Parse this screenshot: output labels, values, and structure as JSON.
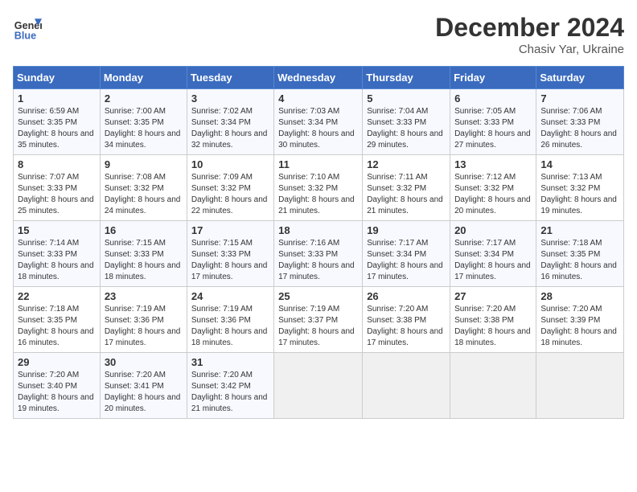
{
  "header": {
    "logo_text_line1": "General",
    "logo_text_line2": "Blue",
    "month": "December 2024",
    "location": "Chasiv Yar, Ukraine"
  },
  "weekdays": [
    "Sunday",
    "Monday",
    "Tuesday",
    "Wednesday",
    "Thursday",
    "Friday",
    "Saturday"
  ],
  "weeks": [
    [
      {
        "day": "1",
        "sunrise": "6:59 AM",
        "sunset": "3:35 PM",
        "daylight": "8 hours and 35 minutes."
      },
      {
        "day": "2",
        "sunrise": "7:00 AM",
        "sunset": "3:35 PM",
        "daylight": "8 hours and 34 minutes."
      },
      {
        "day": "3",
        "sunrise": "7:02 AM",
        "sunset": "3:34 PM",
        "daylight": "8 hours and 32 minutes."
      },
      {
        "day": "4",
        "sunrise": "7:03 AM",
        "sunset": "3:34 PM",
        "daylight": "8 hours and 30 minutes."
      },
      {
        "day": "5",
        "sunrise": "7:04 AM",
        "sunset": "3:33 PM",
        "daylight": "8 hours and 29 minutes."
      },
      {
        "day": "6",
        "sunrise": "7:05 AM",
        "sunset": "3:33 PM",
        "daylight": "8 hours and 27 minutes."
      },
      {
        "day": "7",
        "sunrise": "7:06 AM",
        "sunset": "3:33 PM",
        "daylight": "8 hours and 26 minutes."
      }
    ],
    [
      {
        "day": "8",
        "sunrise": "7:07 AM",
        "sunset": "3:33 PM",
        "daylight": "8 hours and 25 minutes."
      },
      {
        "day": "9",
        "sunrise": "7:08 AM",
        "sunset": "3:32 PM",
        "daylight": "8 hours and 24 minutes."
      },
      {
        "day": "10",
        "sunrise": "7:09 AM",
        "sunset": "3:32 PM",
        "daylight": "8 hours and 22 minutes."
      },
      {
        "day": "11",
        "sunrise": "7:10 AM",
        "sunset": "3:32 PM",
        "daylight": "8 hours and 21 minutes."
      },
      {
        "day": "12",
        "sunrise": "7:11 AM",
        "sunset": "3:32 PM",
        "daylight": "8 hours and 21 minutes."
      },
      {
        "day": "13",
        "sunrise": "7:12 AM",
        "sunset": "3:32 PM",
        "daylight": "8 hours and 20 minutes."
      },
      {
        "day": "14",
        "sunrise": "7:13 AM",
        "sunset": "3:32 PM",
        "daylight": "8 hours and 19 minutes."
      }
    ],
    [
      {
        "day": "15",
        "sunrise": "7:14 AM",
        "sunset": "3:33 PM",
        "daylight": "8 hours and 18 minutes."
      },
      {
        "day": "16",
        "sunrise": "7:15 AM",
        "sunset": "3:33 PM",
        "daylight": "8 hours and 18 minutes."
      },
      {
        "day": "17",
        "sunrise": "7:15 AM",
        "sunset": "3:33 PM",
        "daylight": "8 hours and 17 minutes."
      },
      {
        "day": "18",
        "sunrise": "7:16 AM",
        "sunset": "3:33 PM",
        "daylight": "8 hours and 17 minutes."
      },
      {
        "day": "19",
        "sunrise": "7:17 AM",
        "sunset": "3:34 PM",
        "daylight": "8 hours and 17 minutes."
      },
      {
        "day": "20",
        "sunrise": "7:17 AM",
        "sunset": "3:34 PM",
        "daylight": "8 hours and 17 minutes."
      },
      {
        "day": "21",
        "sunrise": "7:18 AM",
        "sunset": "3:35 PM",
        "daylight": "8 hours and 16 minutes."
      }
    ],
    [
      {
        "day": "22",
        "sunrise": "7:18 AM",
        "sunset": "3:35 PM",
        "daylight": "8 hours and 16 minutes."
      },
      {
        "day": "23",
        "sunrise": "7:19 AM",
        "sunset": "3:36 PM",
        "daylight": "8 hours and 17 minutes."
      },
      {
        "day": "24",
        "sunrise": "7:19 AM",
        "sunset": "3:36 PM",
        "daylight": "8 hours and 18 minutes."
      },
      {
        "day": "25",
        "sunrise": "7:19 AM",
        "sunset": "3:37 PM",
        "daylight": "8 hours and 17 minutes."
      },
      {
        "day": "26",
        "sunrise": "7:20 AM",
        "sunset": "3:38 PM",
        "daylight": "8 hours and 17 minutes."
      },
      {
        "day": "27",
        "sunrise": "7:20 AM",
        "sunset": "3:38 PM",
        "daylight": "8 hours and 18 minutes."
      },
      {
        "day": "28",
        "sunrise": "7:20 AM",
        "sunset": "3:39 PM",
        "daylight": "8 hours and 18 minutes."
      }
    ],
    [
      {
        "day": "29",
        "sunrise": "7:20 AM",
        "sunset": "3:40 PM",
        "daylight": "8 hours and 19 minutes."
      },
      {
        "day": "30",
        "sunrise": "7:20 AM",
        "sunset": "3:41 PM",
        "daylight": "8 hours and 20 minutes."
      },
      {
        "day": "31",
        "sunrise": "7:20 AM",
        "sunset": "3:42 PM",
        "daylight": "8 hours and 21 minutes."
      },
      null,
      null,
      null,
      null
    ]
  ]
}
